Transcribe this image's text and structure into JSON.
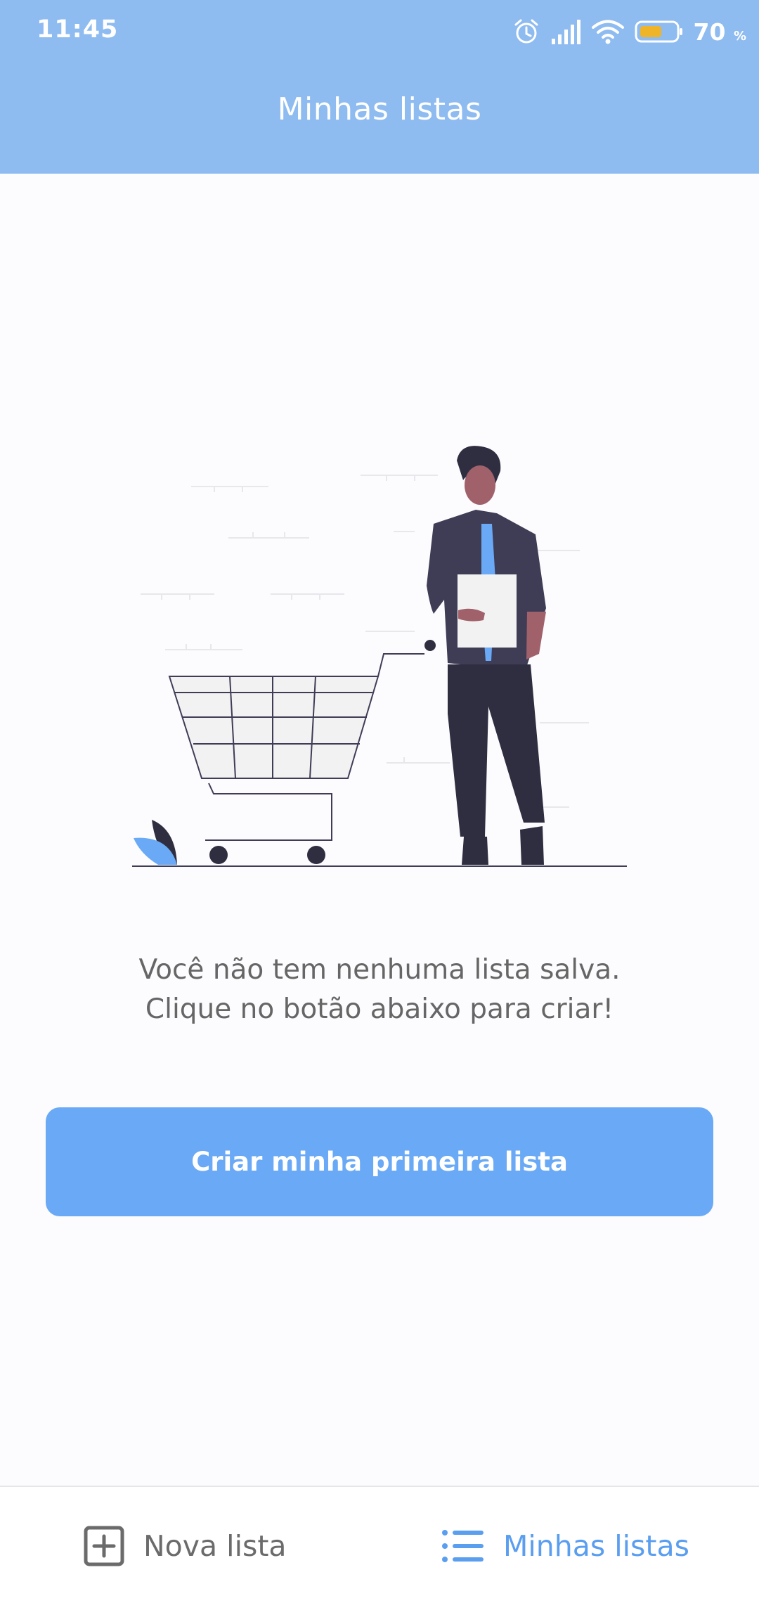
{
  "status_bar": {
    "time": "11:45",
    "battery_percent": "70",
    "battery_unit": "%",
    "icons": [
      "alarm-icon",
      "signal-icon",
      "wifi-icon",
      "battery-icon"
    ]
  },
  "header": {
    "title": "Minhas listas",
    "background": "#8ebbf0"
  },
  "empty_state": {
    "illustration": "person-with-shopping-cart",
    "line1": "Você não tem nenhuma lista salva.",
    "line2": "Clique no botão abaixo para criar!"
  },
  "cta": {
    "label": "Criar minha primeira lista",
    "color": "#6aa9f5"
  },
  "bottom_nav": {
    "items": [
      {
        "label": "Nova lista",
        "icon": "plus-square-icon",
        "active": false
      },
      {
        "label": "Minhas listas",
        "icon": "list-icon",
        "active": true
      }
    ],
    "active_color": "#5a9ef0"
  }
}
